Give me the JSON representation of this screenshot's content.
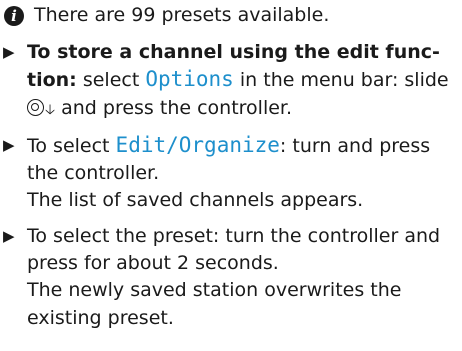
{
  "note": {
    "icon": "info-icon",
    "text": "There are 99 presets available."
  },
  "steps": [
    {
      "bullet_icon": "triangle-right-icon",
      "bold_1": "To store a channel using the edit func-",
      "bold_2": "tion:",
      "text_a": " select ",
      "menu_item": "Options",
      "text_b": " in the menu bar: slide",
      "controller_icon": "controller-icon",
      "down_icon": "arrow-down-icon",
      "text_c": " and press the controller."
    },
    {
      "bullet_icon": "triangle-right-icon",
      "text_a": "To select ",
      "menu_item": "Edit/Organize",
      "text_b": ": turn and press",
      "line_2": "the controller.",
      "result": "The list of saved channels appears."
    },
    {
      "bullet_icon": "triangle-right-icon",
      "line_1": "To select the preset: turn the controller and",
      "line_2": "press for about 2 seconds.",
      "result_1": "The newly saved station overwrites the",
      "result_2": "existing preset."
    }
  ]
}
